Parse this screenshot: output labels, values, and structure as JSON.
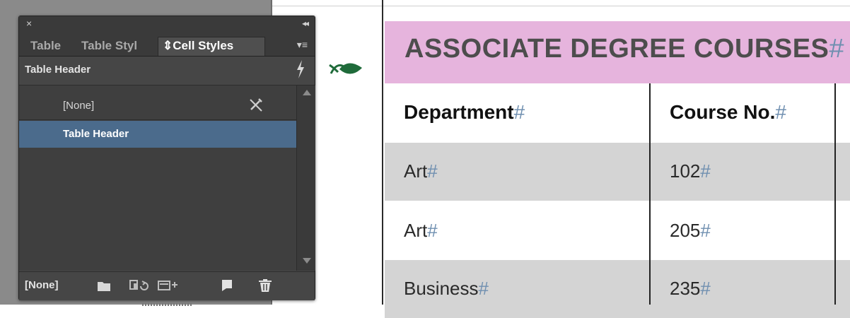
{
  "panel": {
    "close_glyph": "×",
    "collapse_glyph": "◂◂",
    "tabs": [
      {
        "label": "Table",
        "active": false
      },
      {
        "label": "Table Styl",
        "active": false
      },
      {
        "label": "⇕Cell Styles",
        "active": true
      }
    ],
    "menu_glyph": "▾≡",
    "current_style": "Table Header",
    "styles": [
      {
        "label": "[None]",
        "selected": false
      },
      {
        "label": "Table Header",
        "selected": true
      }
    ],
    "footer_style": "[None]",
    "footer_icons": [
      "new-group-icon",
      "load-styles-icon",
      "clear-overrides-icon",
      "new-style-icon",
      "delete-icon"
    ]
  },
  "document": {
    "heading": "ASSOCIATE DEGREE COURSES",
    "hash": "#",
    "columns": [
      "Department",
      "Course No."
    ],
    "rows": [
      [
        "Art",
        "102"
      ],
      [
        "Art",
        "205"
      ],
      [
        "Business",
        "235"
      ]
    ]
  },
  "colors": {
    "header_fill": "#e6b4dd",
    "selection": "#4b6b8c",
    "row_shade": "#d4d4d4"
  }
}
